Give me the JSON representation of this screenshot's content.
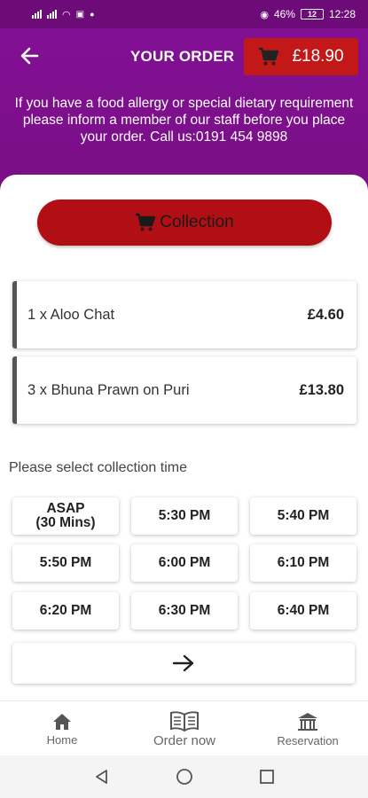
{
  "status_bar": {
    "battery_percent": "46%",
    "battery_level": "12",
    "time": "12:28"
  },
  "header": {
    "title": "YOUR ORDER",
    "cart_total": "£18.90",
    "notice": "If you have a food allergy or special dietary requirement please inform a member of our staff before you place your order. Call us:0191 454 9898"
  },
  "order": {
    "mode_label": "Collection",
    "items": [
      {
        "name": "1 x Aloo Chat",
        "price": "£4.60"
      },
      {
        "name": "3 x Bhuna Prawn on Puri",
        "price": "£13.80"
      }
    ]
  },
  "collection": {
    "prompt": "Please select collection time",
    "slots": [
      "ASAP\n(30 Mins)",
      "5:30 PM",
      "5:40 PM",
      "5:50 PM",
      "6:00 PM",
      "6:10 PM",
      "6:20 PM",
      "6:30 PM",
      "6:40 PM"
    ]
  },
  "bottom_nav": {
    "home": "Home",
    "order_now": "Order now",
    "reservation": "Reservation"
  },
  "icons": {
    "back": "arrow-left-icon",
    "cart": "cart-icon",
    "next": "arrow-right-icon",
    "home": "home-icon",
    "menu": "book-icon",
    "reservation": "building-icon"
  },
  "colors": {
    "header": "#7a0f86",
    "accent_red": "#c21818",
    "collection_red": "#b10f14"
  }
}
